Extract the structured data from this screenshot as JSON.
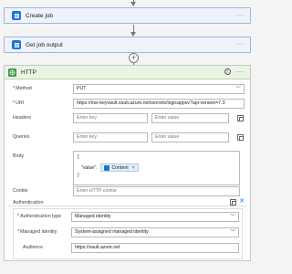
{
  "flow": {
    "steps": [
      {
        "name": "Create job",
        "menu": "···"
      },
      {
        "name": "Get job output",
        "menu": "···"
      }
    ],
    "add_symbol": "+"
  },
  "http": {
    "title": "HTTP",
    "info": "i",
    "menu": "···",
    "fields": {
      "method": {
        "label": "Method",
        "value": "PUT"
      },
      "uri": {
        "label": "URI",
        "value": "https://riss-keyvault.vault.azure.net/secrets/logicappsv?api-version=7.3"
      },
      "headers": {
        "label": "Headers",
        "key_placeholder": "Enter key",
        "value_placeholder": "Enter value"
      },
      "queries": {
        "label": "Queries",
        "key_placeholder": "Enter key",
        "value_placeholder": "Enter value"
      },
      "body": {
        "label": "Body",
        "line1": "{",
        "key": "\"value\":",
        "token": "Content",
        "token_close": "×",
        "line3": "}"
      },
      "cookie": {
        "label": "Cookie",
        "placeholder": "Enter HTTP cookie"
      }
    },
    "authentication": {
      "label": "Authentication",
      "close": "✕",
      "type": {
        "label": "Authentication type",
        "value": "Managed identity"
      },
      "identity": {
        "label": "Managed identity",
        "value": "System-assigned managed identity"
      },
      "audience": {
        "label": "Audience",
        "value": "https://vault.azure.net"
      }
    }
  },
  "colors": {
    "accent": "#1f74d2",
    "http_green": "#3f9a4c",
    "required": "#cc0000"
  }
}
